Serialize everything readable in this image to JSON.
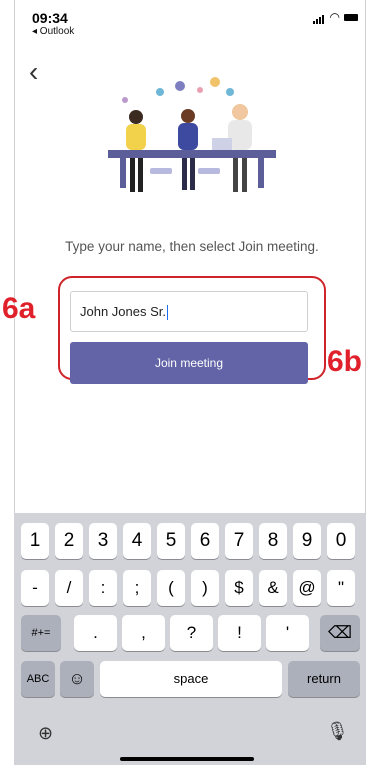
{
  "status": {
    "time": "09:34",
    "back_app": "◂ Outlook"
  },
  "screen": {
    "instruction": "Type your name, then select Join meeting.",
    "name_value": "John Jones Sr.",
    "join_label": "Join meeting"
  },
  "annotations": {
    "tag_a": "6a",
    "tag_b": "6b"
  },
  "keyboard": {
    "row1": [
      "1",
      "2",
      "3",
      "4",
      "5",
      "6",
      "7",
      "8",
      "9",
      "0"
    ],
    "row2": [
      "-",
      "/",
      ":",
      ";",
      "(",
      ")",
      "$",
      "&",
      "@",
      "\""
    ],
    "row3_left": "#+=",
    "row3_mid": [
      ".",
      ",",
      "?",
      "!",
      "'"
    ],
    "abc": "ABC",
    "space": "space",
    "return": "return"
  },
  "colors": {
    "accent": "#6264a7",
    "callout": "#d1232a"
  }
}
